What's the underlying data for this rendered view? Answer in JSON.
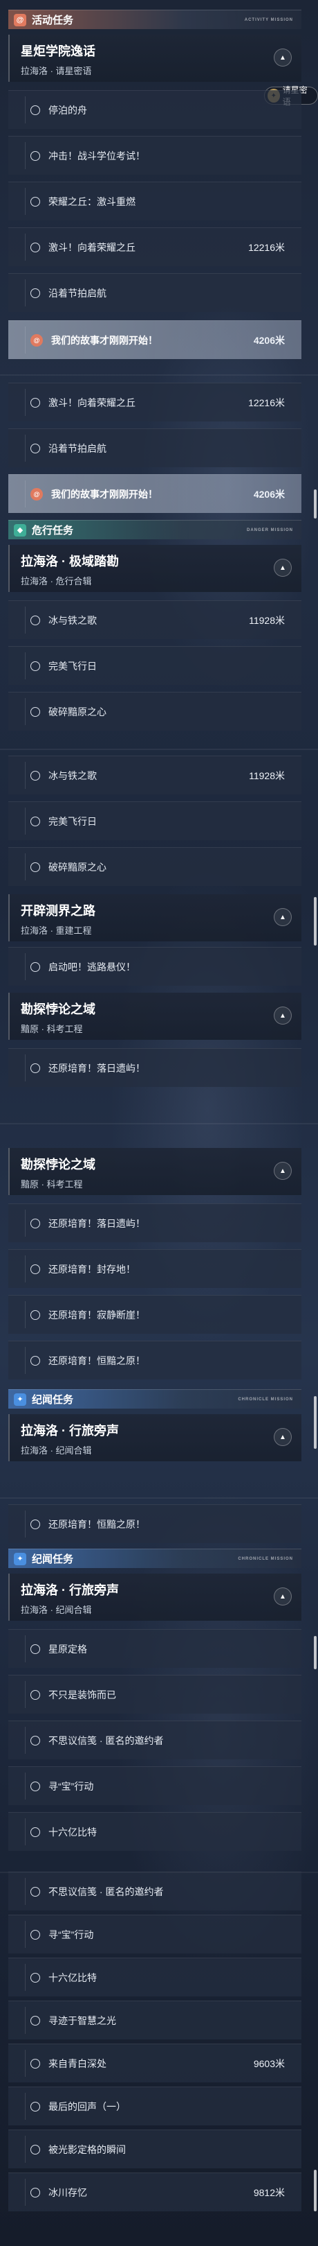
{
  "categories": {
    "activity": {
      "label": "活动任务",
      "tag": "ACTIVITY MISSION"
    },
    "danger": {
      "label": "危行任务",
      "tag": "DANGER MISSION"
    },
    "chronicle": {
      "label": "纪闻任务",
      "tag": "CHRONICLE MISSION"
    }
  },
  "quests": {
    "xingju": {
      "title": "星炬学院逸话",
      "subtitle": "拉海洛 · 请星密语"
    },
    "jiyu": {
      "title": "拉海洛 · 极域踏勘",
      "subtitle": "拉海洛 · 危行合辑"
    },
    "kaipi": {
      "title": "开辟测界之路",
      "subtitle": "拉海洛 · 重建工程"
    },
    "kantan": {
      "title": "勘探悖论之域",
      "subtitle": "黯原 · 科考工程"
    },
    "xinglv": {
      "title": "拉海洛 · 行旅旁声",
      "subtitle": "拉海洛 · 纪闻合辑"
    }
  },
  "tasks": {
    "t1": "停泊的舟",
    "t2": "冲击！战斗学位考试！",
    "t3": "荣耀之丘：激斗重燃",
    "t4": "激斗！向着荣耀之丘",
    "t5": "沿着节拍启航",
    "t6": "我们的故事才刚刚开始！",
    "t7": "冰与铁之歌",
    "t8": "完美飞行日",
    "t9": "破碎黯原之心",
    "t10": "启动吧！逃路悬仪！",
    "t11": "还原培育！落日遗屿！",
    "t12": "还原培育！封存地！",
    "t13": "还原培育！寂静断崖！",
    "t14": "还原培育！恒黯之原！",
    "t15": "星原定格",
    "t16": "不只是装饰而已",
    "t17": "不思议信笺 · 匿名的邀约者",
    "t18": "寻“宝”行动",
    "t19": "十六亿比特",
    "t20": "寻迹于智慧之光",
    "t21": "来自青白深处",
    "t22": "最后的回声（一）",
    "t23": "被光影定格的瞬间",
    "t24": "冰川存忆"
  },
  "distances": {
    "d12216": "12216米",
    "d4206": "4206米",
    "d11928": "11928米",
    "d9603": "9603米",
    "d9812": "9812米"
  },
  "badge": {
    "label": "请星密语"
  },
  "icons": {
    "activity": "spiral-icon",
    "danger": "shield-icon",
    "chronicle": "star-icon",
    "collapse": "chevron-up-icon",
    "task": "circle-icon"
  },
  "colors": {
    "activity": "#e07a5f",
    "danger": "#3fae97",
    "chronicle": "#4a8fe0"
  }
}
